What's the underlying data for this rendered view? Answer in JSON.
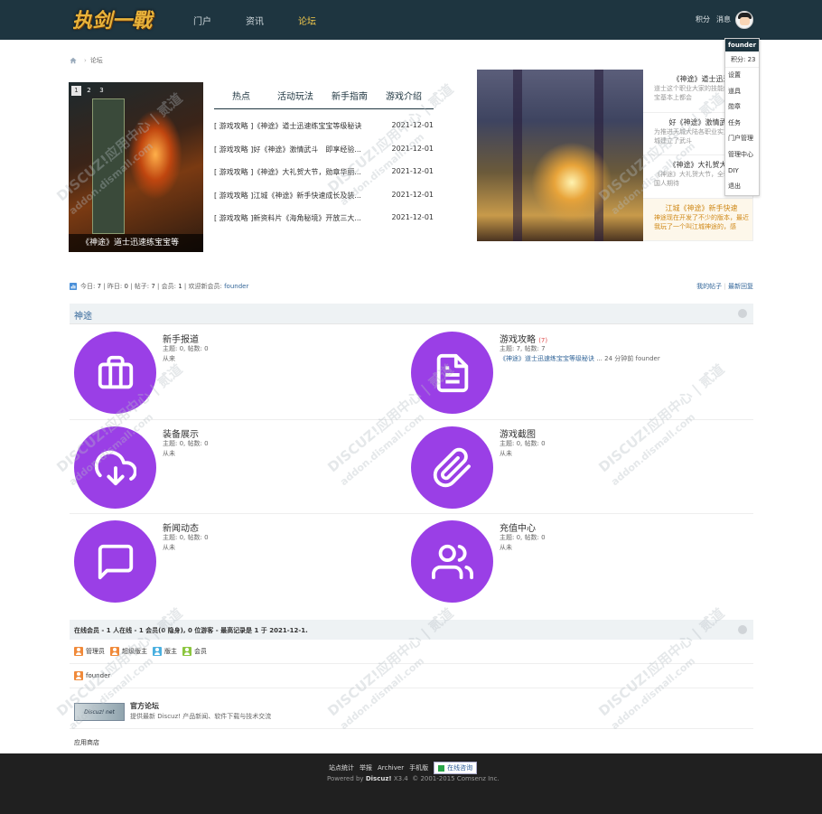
{
  "header": {
    "logo_text": "执剑一戰",
    "nav": [
      "门户",
      "资讯",
      "论坛"
    ],
    "active_nav": "论坛",
    "right_links": [
      "积分",
      "消息",
      "提醒"
    ]
  },
  "user_menu": {
    "username": "founder",
    "points": "积分: 23",
    "items": [
      "设置",
      "道具",
      "勋章",
      "任务",
      "门户管理",
      "管理中心",
      "DIY",
      "退出"
    ]
  },
  "breadcrumb": {
    "current": "论坛"
  },
  "slider": {
    "pages": [
      "1",
      "2",
      "3"
    ],
    "caption": "《神途》道士迅速练宝宝等"
  },
  "news_tabs": [
    "热点",
    "活动玩法",
    "新手指南",
    "游戏介绍"
  ],
  "news": [
    {
      "title": "[ 游戏攻略 ]《神途》道士迅速练宝宝等级秘诀",
      "date": "2021-12-01"
    },
    {
      "title": "[ 游戏攻略 ]好《神途》激情武斗　即享经验...",
      "date": "2021-12-01"
    },
    {
      "title": "[ 游戏攻略 ]《神途》大礼贺大节，勋章华丽...",
      "date": "2021-12-01"
    },
    {
      "title": "[ 游戏攻略 ]江城《神途》新手快速成长及装...",
      "date": "2021-12-01"
    },
    {
      "title": "[ 游戏攻略 ]新资料片《海角秘境》开放三大...",
      "date": "2021-12-01"
    }
  ],
  "right_news": [
    {
      "title": "《神途》道士迅速",
      "body": "道士这个职业大家的技能练级、打宝基本上都会"
    },
    {
      "title": "好《神途》激情武斗",
      "body": "为推进天城大陆各职业实力，昆山城建立了武斗"
    },
    {
      "title": "《神途》大礼贺大节",
      "body": "《神途》大礼贺大节，全骑霸气　　国人期待"
    },
    {
      "title": "江城《神途》新手快速",
      "body": "神途现在开发了不少的版本，最近我玩了一个叫江城神途的，感"
    }
  ],
  "stats": {
    "today_label": "今日:",
    "today": "7",
    "yesterday_label": "昨日:",
    "yesterday": "0",
    "posts_label": "帖子:",
    "posts": "7",
    "members_label": "会员:",
    "members": "1",
    "welcome": "欢迎新会员:",
    "new_member": "founder",
    "my_posts": "我的帖子",
    "latest_reply": "最新回复"
  },
  "category": {
    "name": "神途"
  },
  "forums": [
    {
      "name": "新手报道",
      "new_count": "",
      "meta": "主题: 0, 帖数: 0",
      "last": "从来",
      "last_link": "",
      "icon": "briefcase-icon"
    },
    {
      "name": "游戏攻略",
      "new_count": "(7)",
      "meta": "主题: 7, 帖数: 7",
      "last": "... 24 分钟前 founder",
      "last_link": "《神途》道士迅速练宝宝等级秘诀",
      "icon": "document-icon"
    },
    {
      "name": "装备展示",
      "new_count": "",
      "meta": "主题: 0, 帖数: 0",
      "last": "从未",
      "last_link": "",
      "icon": "cloud-download-icon"
    },
    {
      "name": "游戏截图",
      "new_count": "",
      "meta": "主题: 0, 帖数: 0",
      "last": "从未",
      "last_link": "",
      "icon": "paperclip-icon"
    },
    {
      "name": "新闻动态",
      "new_count": "",
      "meta": "主题: 0, 帖数: 0",
      "last": "从未",
      "last_link": "",
      "icon": "message-icon"
    },
    {
      "name": "充值中心",
      "new_count": "",
      "meta": "主题: 0, 帖数: 0",
      "last": "从未",
      "last_link": "",
      "icon": "users-icon"
    }
  ],
  "online": {
    "summary": "在线会员 - 1 人在线 - 1 会员(0 隐身), 0 位游客 - 最高记录是 1 于 2021-12-1.",
    "legend": [
      {
        "label": "管理员",
        "color": "#f08a3a"
      },
      {
        "label": "超级版主",
        "color": "#f08a3a"
      },
      {
        "label": "版主",
        "color": "#4ab0e0"
      },
      {
        "label": "会员",
        "color": "#8cc63f"
      }
    ],
    "user": "founder"
  },
  "links": {
    "logo_text": "Discuz! net",
    "name": "官方论坛",
    "desc": "提供最新 Discuz! 产品新闻、软件下载与技术交流",
    "appstore": "应用商店"
  },
  "footer": {
    "links": [
      "站点统计",
      "举报",
      "Archiver",
      "手机版"
    ],
    "online_btn": "在线咨询",
    "powered": "Powered by",
    "brand": "Discuz!",
    "version": "X3.4",
    "copyright": "© 2001-2015 Comsenz Inc."
  },
  "watermark": {
    "text": "DISCUZ!应用中心 | 贰道",
    "sub": "addon.dismall.com"
  },
  "colors": {
    "header_bg": "#1e3540",
    "accent": "#9a3fe6",
    "link": "#336699",
    "footer_bg": "#202020"
  }
}
